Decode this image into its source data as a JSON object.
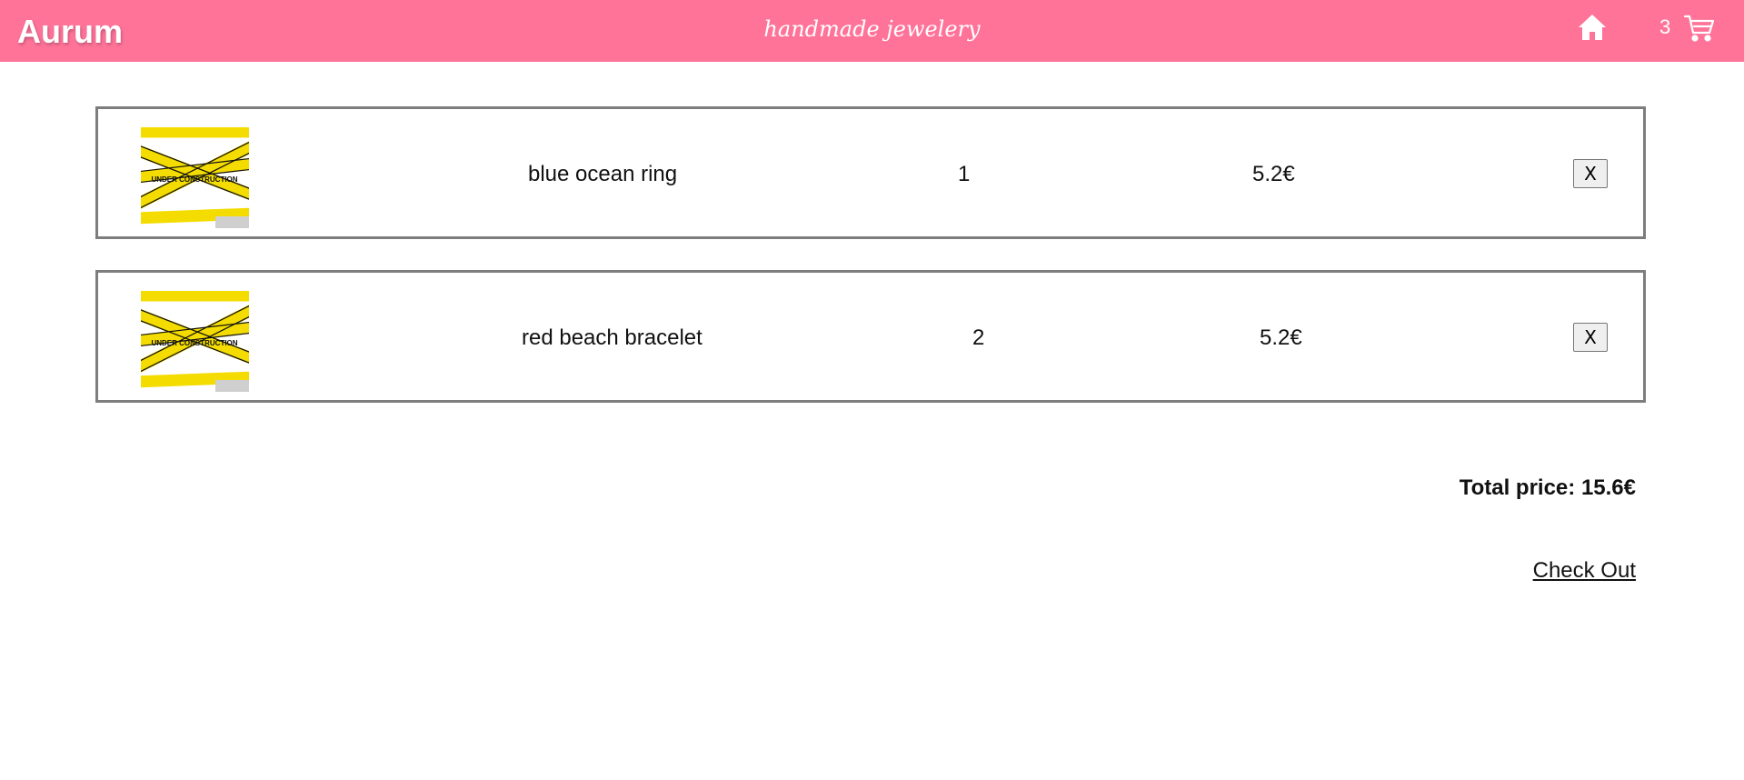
{
  "header": {
    "brand": "Aurum",
    "tagline": "handmade jewelery",
    "cart_count": "3",
    "home_icon": "home-icon",
    "cart_icon": "shopping-cart-icon",
    "background_color": "#ff7399"
  },
  "cart": {
    "items": [
      {
        "name": "blue ocean ring",
        "quantity": "1",
        "price": "5.2€",
        "remove_label": "X",
        "image_label": "UNDER CONSTRUCTION"
      },
      {
        "name": "red beach bracelet",
        "quantity": "2",
        "price": "5.2€",
        "remove_label": "X",
        "image_label": "UNDER CONSTRUCTION"
      }
    ],
    "total_text": "Total price: 15.6€",
    "checkout_label": "Check Out"
  }
}
